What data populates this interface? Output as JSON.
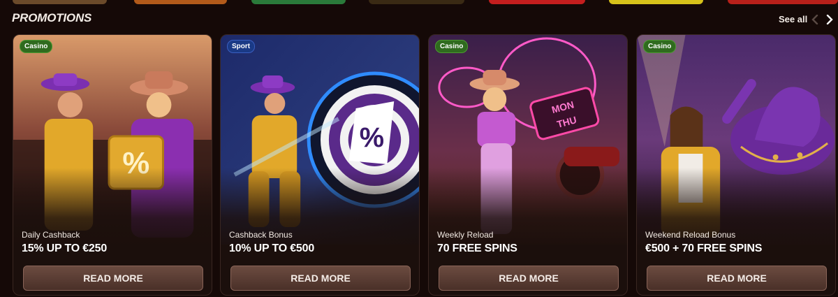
{
  "colors": {
    "background": "#150907",
    "card": "#1b0f0c",
    "button": "#5a3c32",
    "casino_badge": "#2f6b1e",
    "sport_badge": "#1a3a86"
  },
  "header": {
    "title": "PROMOTIONS",
    "see_all": "See all",
    "prev_icon": "chevron-left-icon",
    "next_icon": "chevron-right-icon"
  },
  "cards": [
    {
      "badge": "Casino",
      "name": "Daily Cashback",
      "offer": "15% UP TO €250",
      "button": "READ MORE",
      "image": "cowboy-and-cowgirl-with-percent-briefcase"
    },
    {
      "badge": "Sport",
      "name": "Cashback Bonus",
      "offer": "10% UP TO €500",
      "button": "READ MORE",
      "image": "cowboy-throwing-dart-at-dartboard"
    },
    {
      "badge": "Casino",
      "name": "Weekly Reload",
      "offer": "70 FREE SPINS",
      "button": "READ MORE",
      "image": "cowgirl-with-lasso-and-mon-thu-neon-sign"
    },
    {
      "badge": "Casino",
      "name": "Weekend Reload Bonus",
      "offer": "€500 + 70 FREE SPINS",
      "button": "READ MORE",
      "image": "singer-with-purple-hat"
    }
  ]
}
